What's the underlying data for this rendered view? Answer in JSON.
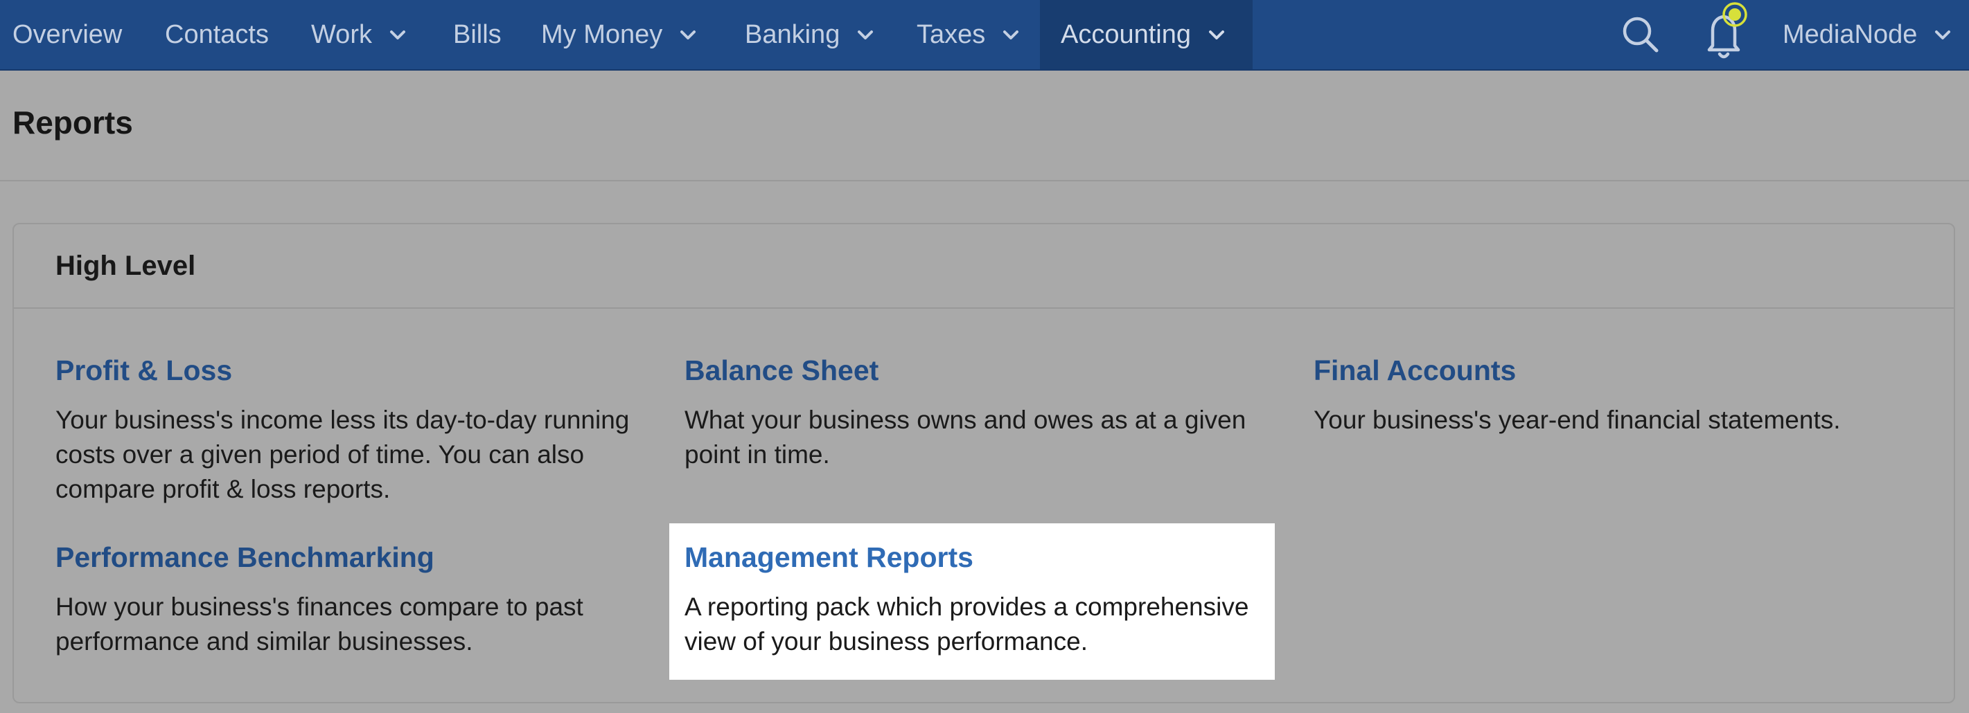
{
  "nav": {
    "items": [
      {
        "label": "Overview",
        "has_dropdown": false,
        "active": false
      },
      {
        "label": "Contacts",
        "has_dropdown": false,
        "active": false
      },
      {
        "label": "Work",
        "has_dropdown": true,
        "active": false
      },
      {
        "label": "Bills",
        "has_dropdown": false,
        "active": false
      },
      {
        "label": "My Money",
        "has_dropdown": true,
        "active": false
      },
      {
        "label": "Banking",
        "has_dropdown": true,
        "active": false
      },
      {
        "label": "Taxes",
        "has_dropdown": true,
        "active": false
      },
      {
        "label": "Accounting",
        "has_dropdown": true,
        "active": true
      }
    ],
    "account_name": "MediaNode",
    "icons": [
      "search-icon",
      "notification-bell-icon",
      "chevron-down-icon"
    ],
    "colors": {
      "bar": "#1f4a86",
      "active": "#183d70",
      "notification_dot": "#d7e03a"
    }
  },
  "page": {
    "title": "Reports"
  },
  "panel": {
    "title": "High Level",
    "reports": [
      {
        "title": "Profit & Loss",
        "lines": [
          "Your business's income less its day-to-day running",
          "costs over a given period of time. You can also",
          "compare profit & loss reports."
        ],
        "highlighted": false
      },
      {
        "title": "Balance Sheet",
        "lines": [
          "What your business owns and owes as at a given",
          "point in time."
        ],
        "highlighted": false
      },
      {
        "title": "Final Accounts",
        "lines": [
          "Your business's year-end financial statements."
        ],
        "highlighted": false
      },
      {
        "title": "Performance Benchmarking",
        "lines": [
          "How your business's finances compare to past",
          "performance and similar businesses."
        ],
        "highlighted": false
      },
      {
        "title": "Management Reports",
        "lines": [
          "A reporting pack which provides a comprehensive",
          "view of your business performance."
        ],
        "highlighted": true
      }
    ]
  }
}
